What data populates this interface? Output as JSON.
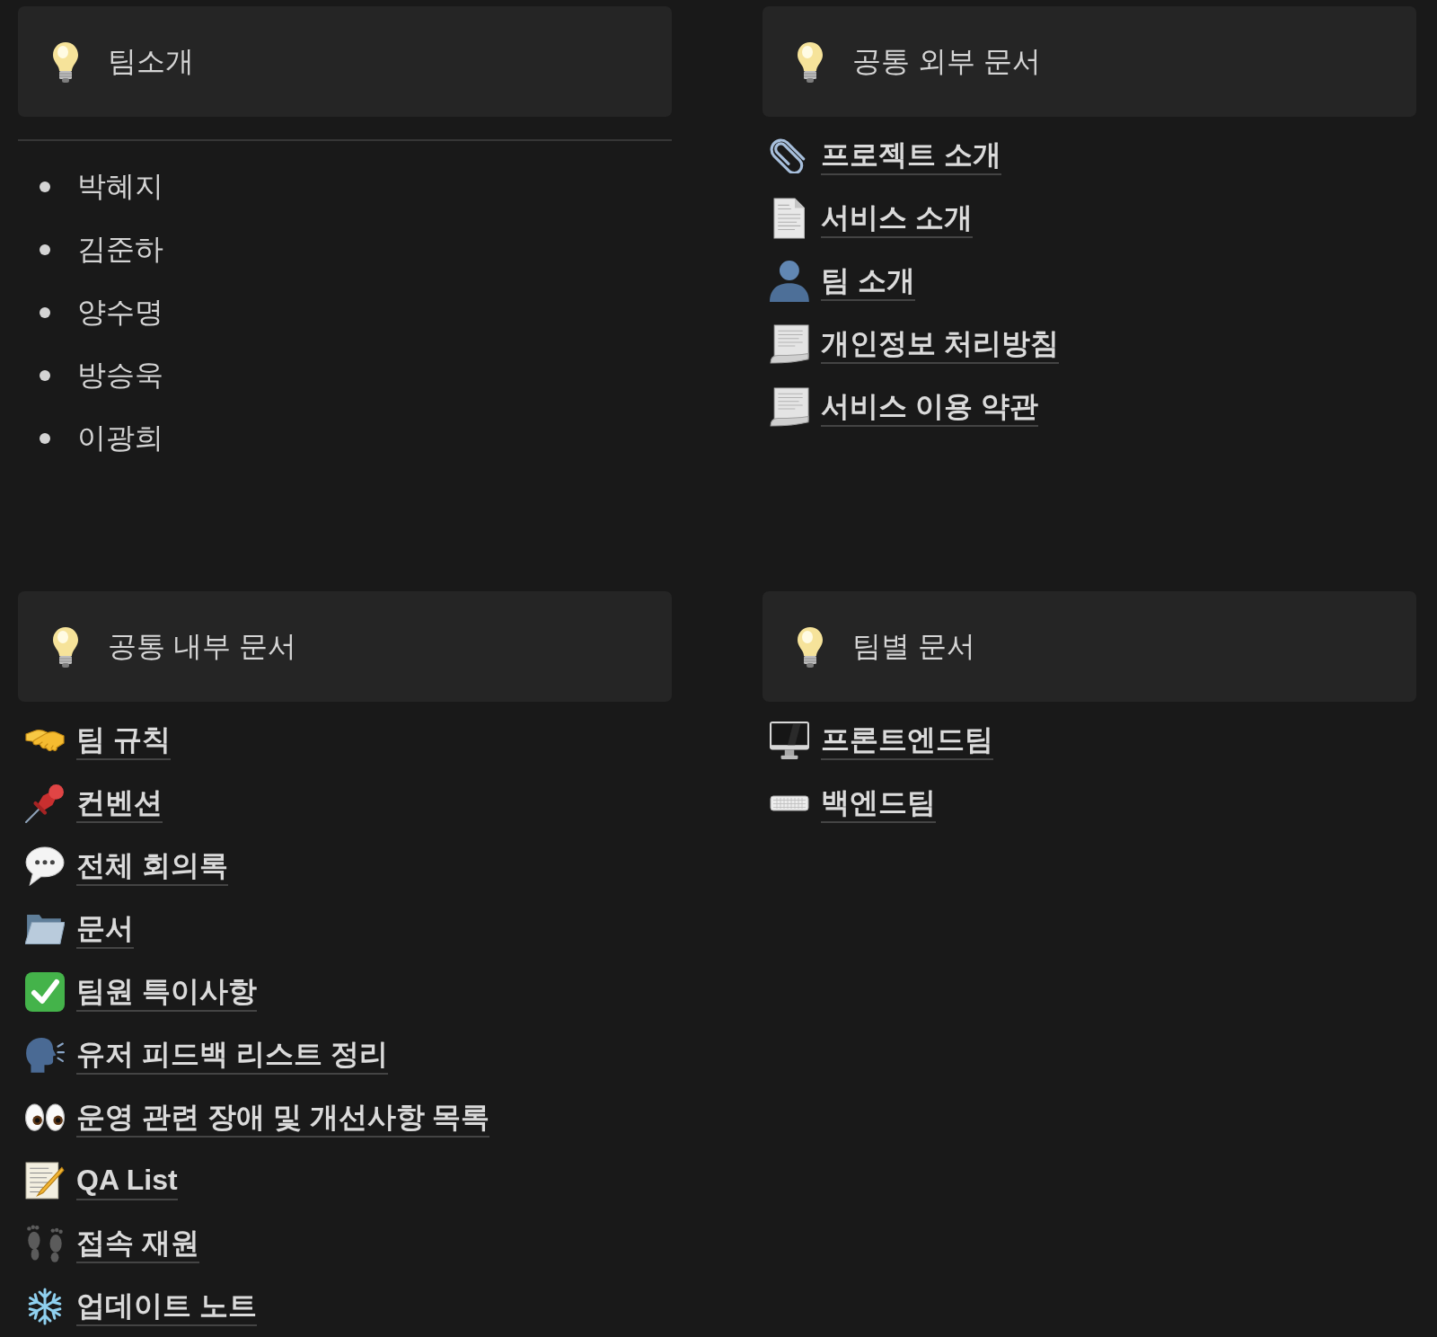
{
  "sections": [
    {
      "kind": "bullets",
      "title": "팀소개",
      "items": [
        "박혜지",
        "김준하",
        "양수명",
        "방승욱",
        "이광희"
      ]
    },
    {
      "kind": "links",
      "title": "공통 외부 문서",
      "items": [
        "프로젝트 소개",
        "서비스 소개",
        "팀 소개",
        "개인정보 처리방침",
        "서비스 이용 약관"
      ]
    },
    {
      "kind": "links",
      "title": "공통 내부 문서",
      "items": [
        "팀 규칙",
        "컨벤션",
        "전체 회의록",
        "문서",
        "팀원 특이사항",
        "유저 피드백 리스트 정리",
        "운영 관련 장애 및 개선사항 목록",
        "QA List",
        "접속 재원",
        "업데이트 노트"
      ]
    },
    {
      "kind": "links",
      "title": "팀별 문서",
      "items": [
        "프론트엔드팀",
        "백엔드팀"
      ]
    }
  ]
}
